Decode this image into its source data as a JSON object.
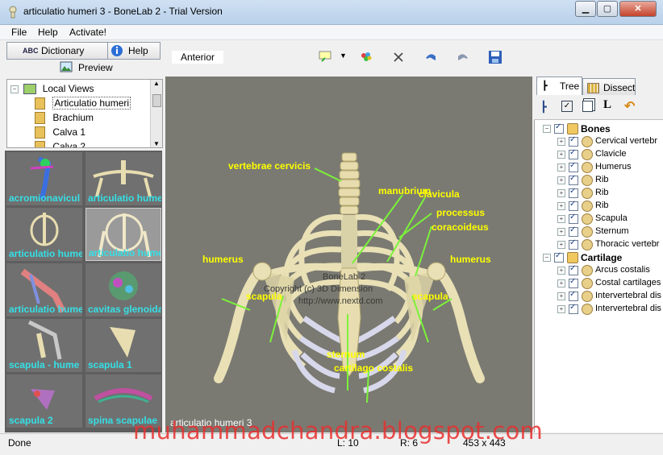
{
  "window": {
    "title": "articulatio humeri 3 - BoneLab 2 - Trial Version"
  },
  "menu": {
    "file": "File",
    "help": "Help",
    "activate": "Activate!"
  },
  "left": {
    "tab_dictionary": "Dictionary",
    "tab_help": "Help",
    "preview_label": "Preview",
    "views": [
      {
        "label": "Local Views"
      },
      {
        "label": "Articulatio humeri"
      },
      {
        "label": "Brachium"
      },
      {
        "label": "Calva 1"
      },
      {
        "label": "Calva 2"
      }
    ],
    "thumbnails": [
      {
        "label": "acromionavicul"
      },
      {
        "label": "articulatio hume"
      },
      {
        "label": "articulatio hume"
      },
      {
        "label": "articulatio hume"
      },
      {
        "label": "articulatio hume"
      },
      {
        "label": "cavitas glenoida"
      },
      {
        "label": "scapula - hume"
      },
      {
        "label": "scapula 1"
      },
      {
        "label": "scapula 2"
      },
      {
        "label": "spina scapulae"
      }
    ]
  },
  "viewer": {
    "view_tab": "Anterior",
    "caption": "articulatio humeri 3",
    "overlay": [
      "BoneLab 2",
      "Copyright (c) 3D Dimension",
      "http://www.nextd.com"
    ],
    "labels": {
      "vertebrae_cervicis": "vertebrae cervicis",
      "manubrium": "manubrium",
      "clavicula": "clavicula",
      "processus": "processus",
      "coracoideus": "coracoideus",
      "humerus_left": "humerus",
      "humerus_right": "humerus",
      "scapula_left": "scapula",
      "scapula_right": "scapula",
      "sternum": "sternum",
      "cartilago_costalis": "cartilago costalis"
    }
  },
  "right": {
    "tab_tree": "Tree",
    "tab_dissect": "Dissect",
    "tree": [
      {
        "label": "Bones",
        "group": true
      },
      {
        "label": "Cervical vertebr"
      },
      {
        "label": "Clavicle"
      },
      {
        "label": "Humerus"
      },
      {
        "label": "Rib"
      },
      {
        "label": "Rib"
      },
      {
        "label": "Rib"
      },
      {
        "label": "Scapula"
      },
      {
        "label": "Sternum"
      },
      {
        "label": "Thoracic vertebr"
      },
      {
        "label": "Cartilage",
        "group": true
      },
      {
        "label": "Arcus costalis"
      },
      {
        "label": "Costal cartilages"
      },
      {
        "label": "Intervertebral dis"
      },
      {
        "label": "Intervertebral dis"
      }
    ]
  },
  "status": {
    "state": "Done",
    "l": "L: 10",
    "r": "R: 6",
    "size": "453 x 443"
  },
  "watermark": "muhammadchandra.blogspot.com",
  "colors": {
    "label_yellow": "#ffff00",
    "leader_green": "#7cf23a",
    "thumb_label": "#35e0e6",
    "watermark_red": "#e83030"
  }
}
